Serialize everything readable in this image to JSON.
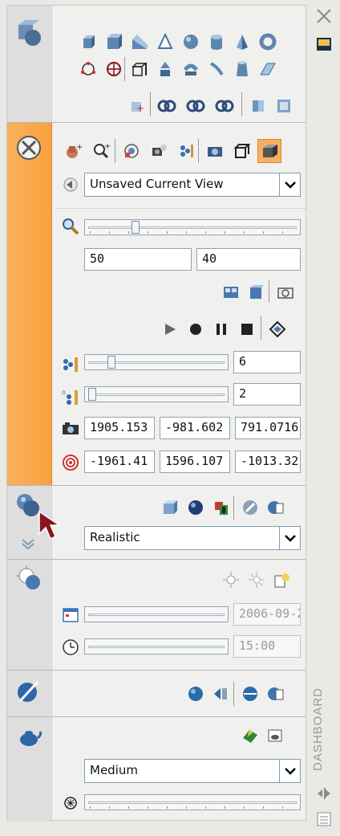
{
  "side": {
    "title": "DASHBOARD"
  },
  "navigation": {
    "view_combo": {
      "value": "Unsaved Current View"
    },
    "zoom": {
      "field1": "50",
      "field2": "40"
    },
    "step_size": {
      "value": "6"
    },
    "steps_per_second": {
      "value": "2"
    },
    "camera_position": {
      "x": "1905.153",
      "y": "-981.602",
      "z": "791.0716"
    },
    "target_position": {
      "x": "-1961.41",
      "y": "1596.107",
      "z": "-1013.32"
    }
  },
  "visual_styles": {
    "combo": {
      "value": "Realistic"
    }
  },
  "lights": {
    "date": "2006-09-2",
    "time": "15:00"
  },
  "render": {
    "combo": {
      "value": "Medium"
    }
  },
  "colors": {
    "accent": "#f7a23f",
    "active": "#f8b060",
    "field_border": "#8fa3b4"
  }
}
